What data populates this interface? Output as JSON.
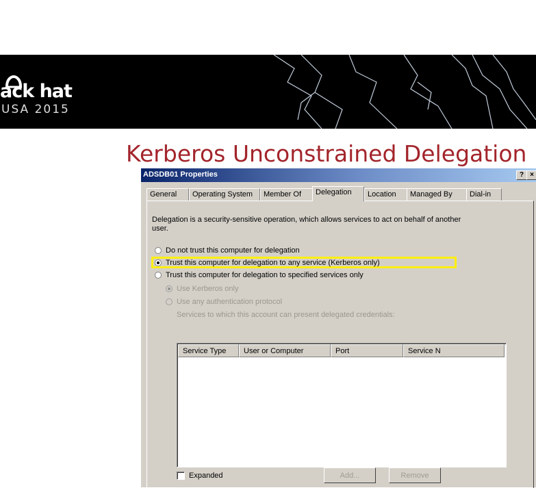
{
  "banner": {
    "logo_text": "ack hat",
    "logo_sub": "USA 2015"
  },
  "slide": {
    "title": "Kerberos Unconstrained Delegation"
  },
  "dialog": {
    "title": "ADSDB01 Properties",
    "help_button": "?",
    "close_button": "×",
    "tabs": [
      {
        "label": "General"
      },
      {
        "label": "Operating System"
      },
      {
        "label": "Member Of"
      },
      {
        "label": "Delegation"
      },
      {
        "label": "Location"
      },
      {
        "label": "Managed By"
      },
      {
        "label": "Dial-in"
      }
    ],
    "active_tab": "Delegation",
    "description": "Delegation is a security-sensitive operation, which allows services to act on behalf of another user.",
    "options": {
      "no_trust": "Do not trust this computer for delegation",
      "trust_any": "Trust this computer for delegation to any service (Kerberos only)",
      "trust_specified": "Trust this computer for delegation to specified services only",
      "use_kerberos": "Use Kerberos only",
      "use_any_auth": "Use any authentication protocol"
    },
    "selected_option": "trust_any",
    "services_label": "Services to which this account can present delegated credentials:",
    "columns": [
      "Service Type",
      "User or Computer",
      "Port",
      "Service N"
    ],
    "rows": [],
    "expanded_label": "Expanded",
    "expanded_checked": false,
    "add_button": "Add...",
    "remove_button": "Remove"
  },
  "colors": {
    "title_red": "#a3242b",
    "highlight_yellow": "#ffee11",
    "dialog_face": "#d4d0c8",
    "titlebar_blue": "#0a246a"
  }
}
